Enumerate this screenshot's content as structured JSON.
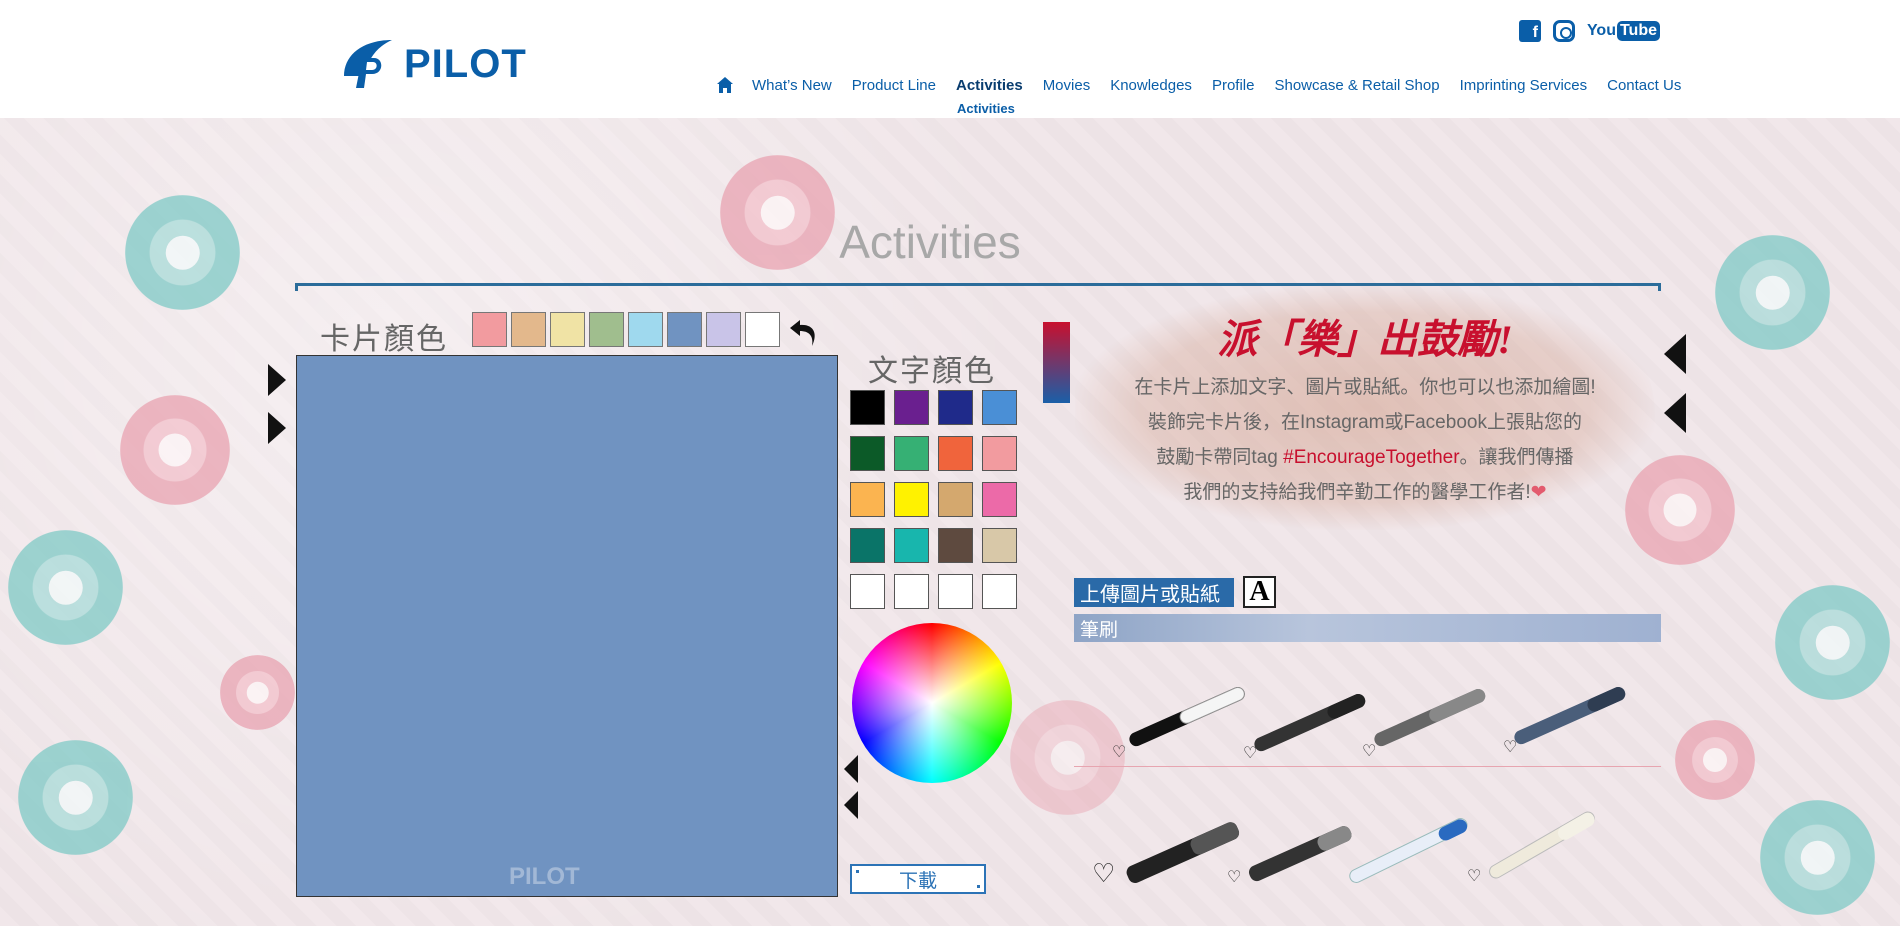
{
  "header": {
    "logo_text": "PILOT",
    "social": {
      "facebook": "f",
      "youtube_you": "You",
      "youtube_tube": "Tube"
    },
    "nav": [
      {
        "label": "What’s New"
      },
      {
        "label": "Product Line"
      },
      {
        "label": "Activities",
        "active": true
      },
      {
        "label": "Movies"
      },
      {
        "label": "Knowledges"
      },
      {
        "label": "Profile"
      },
      {
        "label": "Showcase & Retail Shop"
      },
      {
        "label": "Imprinting Services"
      },
      {
        "label": "Contact Us"
      }
    ],
    "subnav": "Activities",
    "brand_color": "#0a5ea8"
  },
  "page_title": "Activities",
  "editor": {
    "card_color_label": "卡片顏色",
    "card_colors": [
      "#f29b9f",
      "#e3b88c",
      "#f0e3a5",
      "#a0be8e",
      "#9fd9ee",
      "#7093c1",
      "#c9c4e8",
      "#ffffff"
    ],
    "selected_card_color": "#7093c1",
    "watermark": "PILOT",
    "text_color_label": "文字顏色",
    "text_colors": [
      "#000000",
      "#6a1f8f",
      "#1f2a8a",
      "#4a8fd6",
      "#0c5a28",
      "#36b074",
      "#f0643c",
      "#f29b9f",
      "#fbb450",
      "#fff200",
      "#d4a86e",
      "#ec6aa8",
      "#0a7468",
      "#18b6ad",
      "#5e4a3f",
      "#d8c8a8",
      "#ffffff",
      "#ffffff",
      "#ffffff",
      "#ffffff"
    ],
    "download_label": "下載"
  },
  "encourage": {
    "title": "派「樂」出鼓勵!",
    "line1": "在卡片上添加文字、圖片或貼紙。你也可以也添加繪圖!",
    "line2": "裝飾完卡片後，在Instagram或Facebook上張貼您的",
    "line3_pre": "鼓勵卡帶同tag ",
    "line3_tag": "#EncourageTogether",
    "line3_post": "。讓我們傳播",
    "line4": "我們的支持給我們辛勤工作的醫學工作者!",
    "accent": "#c8102e"
  },
  "tools": {
    "upload_label": "上傳圖片或貼紙",
    "text_tool_label": "A",
    "brush_label": "筆刷"
  }
}
